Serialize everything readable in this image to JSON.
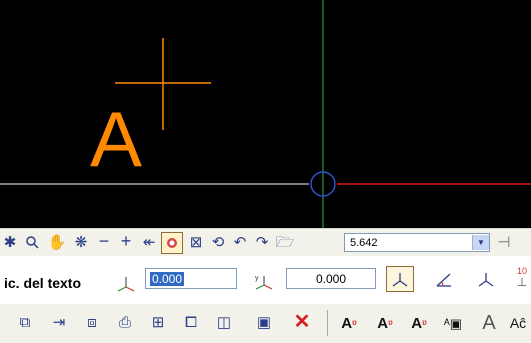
{
  "canvas": {
    "background": "#000000",
    "text_glyph": "A",
    "text_color": "#ff8a00",
    "cross_color": "#ff8a00",
    "x_axis_color": "#d01a1a",
    "y_axis_color": "#2cb84a",
    "grid_line_color": "#ffffff",
    "ucs_marker_color": "#2a54c8"
  },
  "view_toolbar": {
    "buttons": [
      "pan-icon",
      "zoom-icon",
      "hand-icon",
      "zoom-extents-icon",
      "minus-icon",
      "plus-icon",
      "arrow-left-icon",
      "target-icon",
      "zoom-window-icon",
      "rotate-view-icon",
      "undo-view-icon",
      "redo-view-icon",
      "open-folder-icon"
    ],
    "zoom_value": "5.642"
  },
  "text_toolbar": {
    "label": "ic. del texto",
    "x_value": "0.000",
    "y_value": "0.000",
    "right_partial_label": "10"
  },
  "edit_toolbar": {
    "buttons": [
      "copy-icon",
      "move-icon",
      "mirror-icon",
      "print-icon",
      "stretch-icon",
      "array-icon",
      "scale-icon",
      "window-icon",
      "delete-icon"
    ],
    "text_buttons": [
      "text-style-1-icon",
      "text-style-2-icon",
      "text-style-3-icon",
      "text-frame-icon",
      "text-size-icon",
      "text-char-icon"
    ]
  }
}
